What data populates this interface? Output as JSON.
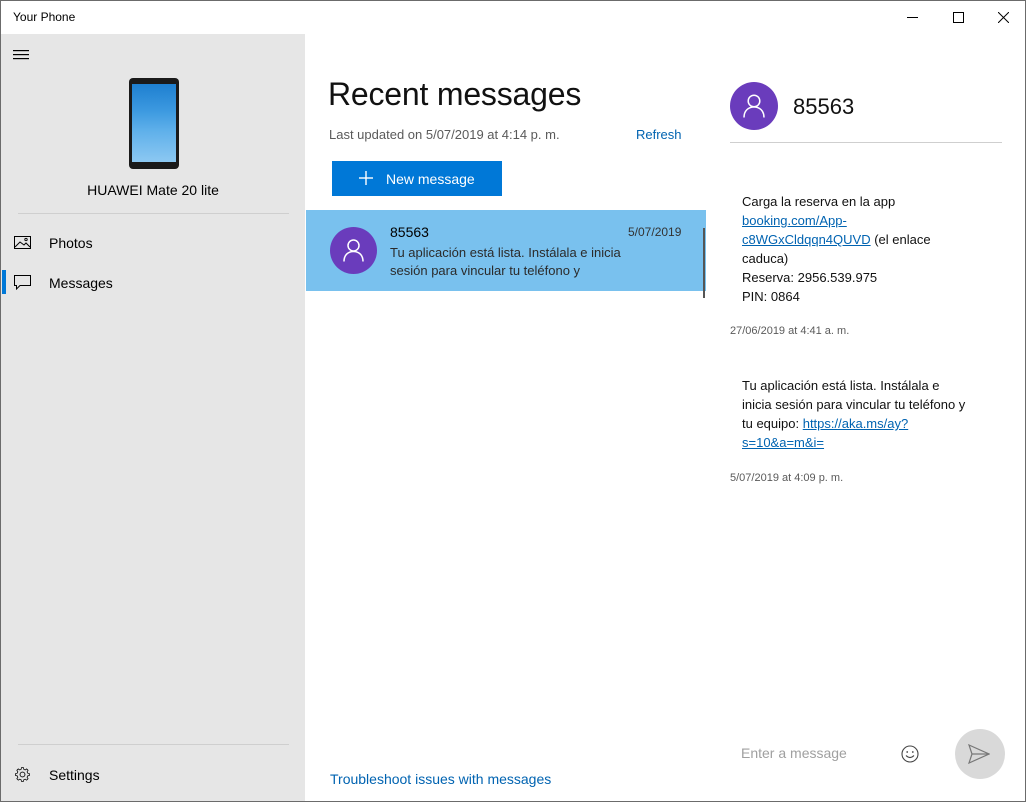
{
  "window": {
    "title": "Your Phone"
  },
  "sidebar": {
    "device_name": "HUAWEI Mate 20 lite",
    "items": [
      {
        "label": "Photos",
        "icon": "photos-icon"
      },
      {
        "label": "Messages",
        "icon": "message-icon",
        "selected": true
      }
    ],
    "settings_label": "Settings"
  },
  "messages_list": {
    "title": "Recent messages",
    "last_updated": "Last updated on 5/07/2019 at 4:14 p. m.",
    "refresh_label": "Refresh",
    "new_message_label": "New message",
    "conversations": [
      {
        "name": "85563",
        "date": "5/07/2019",
        "preview": "Tu aplicación está lista. Instálala e inicia sesión para vincular tu teléfono y"
      }
    ],
    "troubleshoot_label": "Troubleshoot issues with messages"
  },
  "thread": {
    "contact_name": "85563",
    "messages": [
      {
        "line1": "Carga la reserva en la app",
        "link": "booking.com/App-c8WGxCldqqn4QUVD",
        "after_link": " (el enlace caduca)",
        "line3": "Reserva: 2956.539.975",
        "line4": "PIN: 0864",
        "timestamp": "27/06/2019 at 4:41 a. m."
      },
      {
        "text": "Tu aplicación está lista. Instálala e inicia sesión para vincular tu teléfono y tu equipo: ",
        "link": "https://aka.ms/ay?s=10&a=m&i=",
        "timestamp": "5/07/2019 at 4:09 p. m."
      }
    ],
    "compose_placeholder": "Enter a message"
  },
  "colors": {
    "accent": "#0078d7",
    "selected_row": "#79c1ee",
    "avatar": "#6a3cbc",
    "sidebar_bg": "#e6e6e6",
    "link": "#0063b1"
  }
}
